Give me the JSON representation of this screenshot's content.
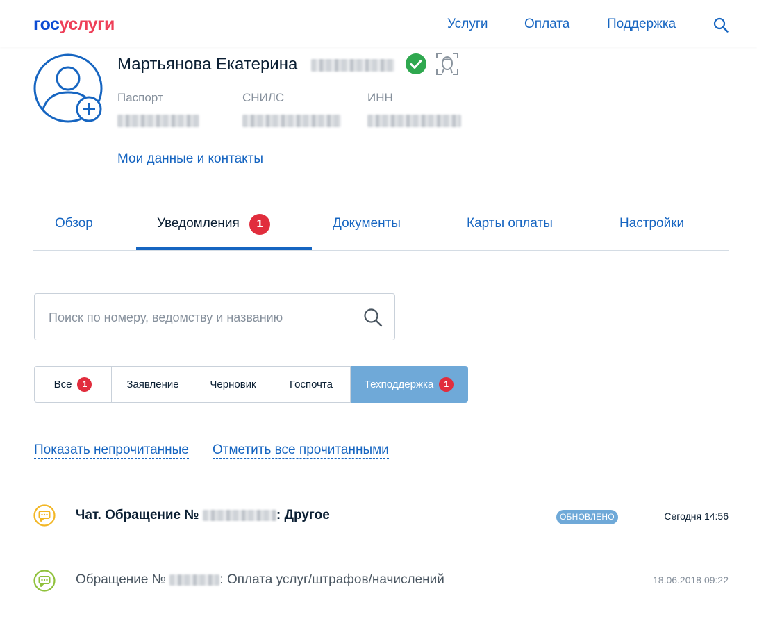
{
  "header": {
    "logo_part1": "гос",
    "logo_part2": "услуги",
    "nav": [
      "Услуги",
      "Оплата",
      "Поддержка"
    ]
  },
  "profile": {
    "name": "Мартьянова Екатерина",
    "docs": [
      {
        "label": "Паспорт"
      },
      {
        "label": "СНИЛС"
      },
      {
        "label": "ИНН"
      }
    ],
    "contacts_link": "Мои данные и контакты"
  },
  "tabs": {
    "items": [
      "Обзор",
      "Уведомления",
      "Документы",
      "Карты оплаты",
      "Настройки"
    ],
    "active": "Уведомления",
    "notifications_count": "1"
  },
  "search": {
    "placeholder": "Поиск по номеру, ведомству и названию"
  },
  "filters": {
    "items": [
      {
        "label": "Все",
        "badge": "1"
      },
      {
        "label": "Заявление"
      },
      {
        "label": "Черновик"
      },
      {
        "label": "Госпочта"
      },
      {
        "label": "Техподдержка",
        "badge": "1"
      }
    ],
    "active": "Техподдержка"
  },
  "actions": {
    "show_unread": "Показать непрочитанные",
    "mark_all_read": "Отметить все прочитанными"
  },
  "notifications": [
    {
      "title_prefix": "Чат. Обращение №",
      "title_suffix": ": Другое",
      "status": "ОБНОВЛЕНО",
      "time": "Сегодня 14:56",
      "unread": true
    },
    {
      "title_prefix": "Обращение №",
      "title_suffix": ": Оплата услуг/штрафов/начислений",
      "time": "18.06.2018 09:22",
      "unread": false
    }
  ],
  "colors": {
    "brand_blue": "#0d4cd3",
    "brand_red": "#ee3f58",
    "link_blue": "#1665c1",
    "badge_red": "#e12d3d",
    "active_filter": "#6fa9d8",
    "verified_green": "#2fa84f",
    "chat_icon_yellow": "#f2b624",
    "chat_icon_green": "#8fc13a"
  },
  "icons": [
    "search-icon",
    "avatar-add-icon",
    "verified-check-icon",
    "face-scan-icon",
    "chat-bubble-icon"
  ]
}
